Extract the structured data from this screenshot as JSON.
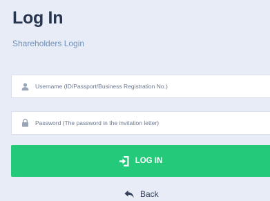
{
  "header": {
    "title": "Log In",
    "subtitle": "Shareholders Login"
  },
  "form": {
    "username": {
      "placeholder": "Username (ID/Passport/Business Registration No.)",
      "value": "",
      "icon": "user-icon"
    },
    "password": {
      "placeholder": "Password (The password in the invitation letter)",
      "value": "",
      "icon": "lock-icon"
    },
    "submit": {
      "label": "LOG IN",
      "icon": "sign-in-icon"
    },
    "back": {
      "label": "Back",
      "icon": "reply-arrow-icon"
    }
  },
  "colors": {
    "background": "#e7ecf6",
    "accent": "#25c97a",
    "subtitle": "#6f8fb8",
    "title": "#27354f"
  }
}
